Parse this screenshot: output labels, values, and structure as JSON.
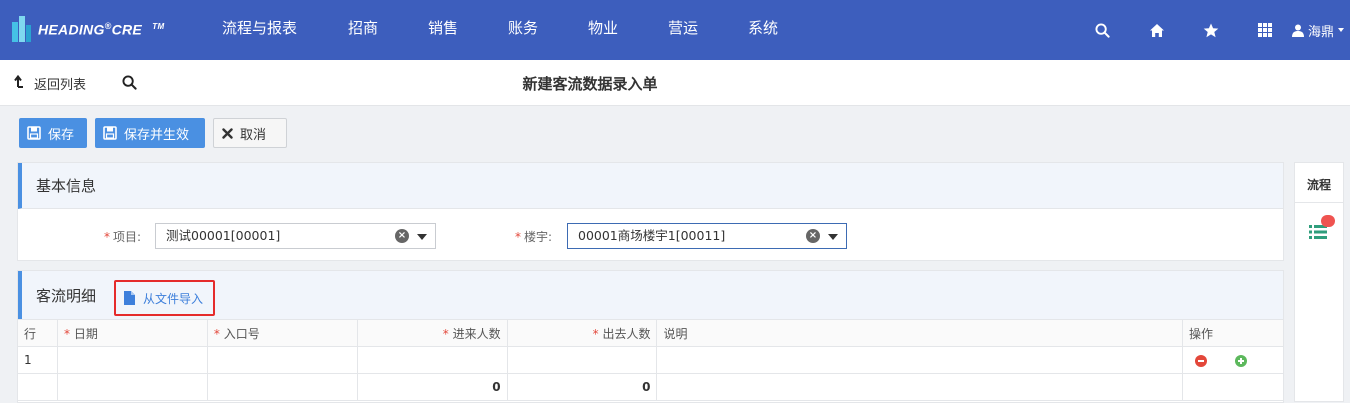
{
  "app": {
    "logo_text": "HEADING",
    "logo_suffix": "CRE",
    "logo_reg": "®",
    "logo_tm": "TM"
  },
  "nav": {
    "items": [
      "流程与报表",
      "招商",
      "销售",
      "账务",
      "物业",
      "营运",
      "系统"
    ],
    "user_name": "海鼎"
  },
  "subheader": {
    "back_label": "返回列表",
    "title": "新建客流数据录入单"
  },
  "toolbar": {
    "save_label": "保存",
    "save_effect_label": "保存并生效",
    "cancel_label": "取消"
  },
  "basic_info": {
    "title": "基本信息",
    "project_label": "项目:",
    "project_value": "测试00001[00001]",
    "building_label": "楼宇:",
    "building_value": "00001商场楼宇1[00011]"
  },
  "detail": {
    "title": "客流明细",
    "import_label": "从文件导入",
    "columns": {
      "row": "行",
      "date": "日期",
      "entrance": "入口号",
      "in_count": "进来人数",
      "out_count": "出去人数",
      "note": "说明",
      "actions": "操作"
    },
    "rows": [
      {
        "row": "1",
        "date": "",
        "entrance": "",
        "in_count": "",
        "out_count": "",
        "note": ""
      }
    ],
    "totals": {
      "in_count": "0",
      "out_count": "0"
    }
  },
  "side_panel": {
    "title": "流程"
  },
  "colors": {
    "nav_bg": "#3d5ebd",
    "primary": "#4a90e2",
    "required": "#e3473a",
    "highlight_border": "#e52b2b",
    "remove": "#e3473a",
    "add": "#5cb85c"
  }
}
